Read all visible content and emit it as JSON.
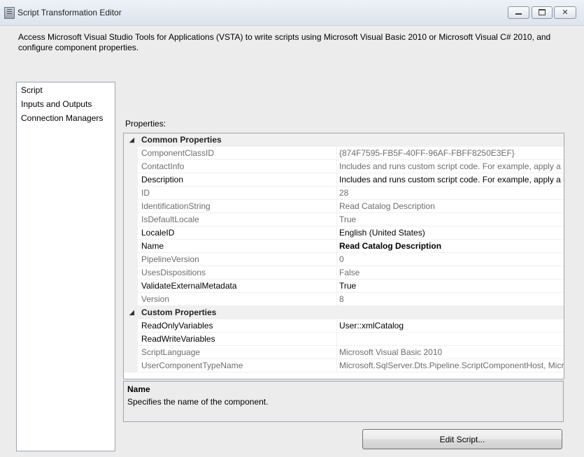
{
  "window": {
    "title": "Script Transformation Editor",
    "close_glyph": "✕"
  },
  "description": "Access Microsoft Visual Studio Tools for Applications (VSTA) to write scripts using Microsoft Visual Basic 2010 or Microsoft Visual C# 2010, and configure component properties.",
  "nav": {
    "items": [
      "Script",
      "Inputs and Outputs",
      "Connection Managers"
    ],
    "selected": "Script"
  },
  "properties_label": "Properties:",
  "categories": {
    "common": {
      "toggle": "◢",
      "name": "Common Properties"
    },
    "custom": {
      "toggle": "◢",
      "name": "Custom Properties"
    }
  },
  "common_rows": [
    {
      "name": "ComponentClassID",
      "value": "{874F7595-FB5F-40FF-96AF-FBFF8250E3EF}",
      "readonly": true
    },
    {
      "name": "ContactInfo",
      "value": "Includes and runs custom script code. For example, apply a b",
      "readonly": true
    },
    {
      "name": "Description",
      "value": "Includes and runs custom script code. For example, apply a b",
      "readonly": false
    },
    {
      "name": "ID",
      "value": "28",
      "readonly": true
    },
    {
      "name": "IdentificationString",
      "value": "Read Catalog Description",
      "readonly": true
    },
    {
      "name": "IsDefaultLocale",
      "value": "True",
      "readonly": true
    },
    {
      "name": "LocaleID",
      "value": "English (United States)",
      "readonly": false
    },
    {
      "name": "Name",
      "value": "Read Catalog Description",
      "readonly": false,
      "bold": true
    },
    {
      "name": "PipelineVersion",
      "value": "0",
      "readonly": true
    },
    {
      "name": "UsesDispositions",
      "value": "False",
      "readonly": true
    },
    {
      "name": "ValidateExternalMetadata",
      "value": "True",
      "readonly": false
    },
    {
      "name": "Version",
      "value": "8",
      "readonly": true
    }
  ],
  "custom_rows": [
    {
      "name": "ReadOnlyVariables",
      "value": "User::xmlCatalog",
      "readonly": false
    },
    {
      "name": "ReadWriteVariables",
      "value": "",
      "readonly": false
    },
    {
      "name": "ScriptLanguage",
      "value": "Microsoft Visual Basic 2010",
      "readonly": true
    },
    {
      "name": "UserComponentTypeName",
      "value": "Microsoft.SqlServer.Dts.Pipeline.ScriptComponentHost, Micr",
      "readonly": true
    }
  ],
  "help": {
    "title": "Name",
    "text": "Specifies the name of the component."
  },
  "edit_button_label": "Edit Script..."
}
